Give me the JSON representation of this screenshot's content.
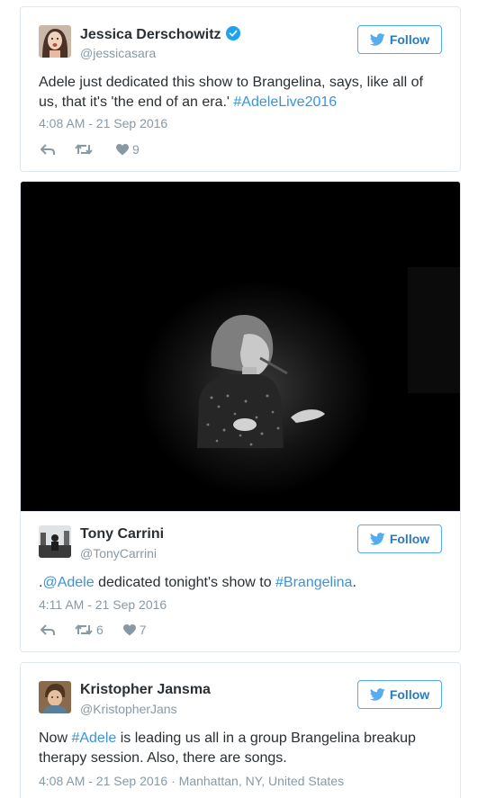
{
  "tweets": [
    {
      "author_name": "Jessica Derschowitz",
      "author_handle": "@jessicasara",
      "verified": true,
      "follow_label": "Follow",
      "text_plain": "Adele just dedicated this show to Brangelina, says, like all of us, that it's 'the end of an era.' ",
      "hashtag": "#AdeleLive2016",
      "timestamp": "4:08 AM - 21 Sep 2016",
      "retweets": "",
      "likes": "9"
    },
    {
      "author_name": "Tony Carrini",
      "author_handle": "@TonyCarrini",
      "verified": false,
      "follow_label": "Follow",
      "text_prefix": ".",
      "mention": "@Adele",
      "text_middle": " dedicated tonight's show to ",
      "hashtag": "#Brangelina",
      "text_suffix": ".",
      "timestamp": "4:11 AM - 21 Sep 2016",
      "retweets": "6",
      "likes": "7"
    },
    {
      "author_name": "Kristopher Jansma",
      "author_handle": "@KristopherJans",
      "verified": false,
      "follow_label": "Follow",
      "text_prefix": "Now ",
      "hashtag": "#Adele",
      "text_rest": " is leading us all in a group Brangelina breakup therapy session. Also, there are songs.",
      "timestamp": "4:08 AM - 21 Sep 2016",
      "location": " · Manhattan, NY, United States"
    }
  ],
  "colors": {
    "link": "#3b94d9",
    "follow_border": "#55acee",
    "follow_text": "#2b7bb9",
    "muted": "#8899a6",
    "border": "#e1e8ed"
  }
}
